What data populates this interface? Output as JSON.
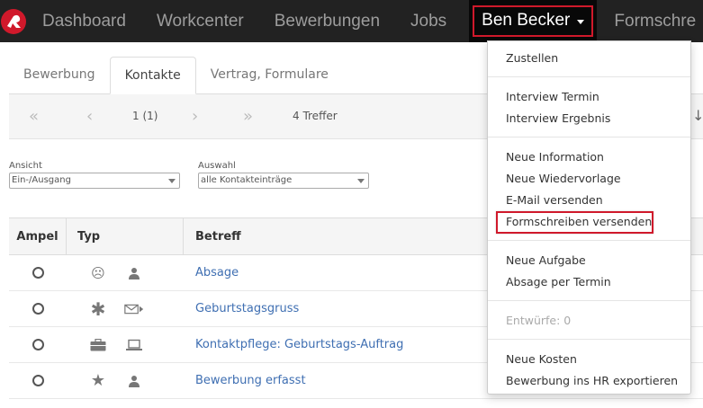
{
  "navbar": {
    "items": [
      "Dashboard",
      "Workcenter",
      "Bewerbungen",
      "Jobs"
    ],
    "user": "Ben Becker",
    "cut_item": "Formschre"
  },
  "tabs": [
    "Bewerbung",
    "Kontakte",
    "Vertrag, Formulare"
  ],
  "pager": {
    "page": "1 (1)",
    "count": "4 Treffer"
  },
  "filters": {
    "ansicht": {
      "label": "Ansicht",
      "value": "Ein-/Ausgang"
    },
    "auswahl": {
      "label": "Auswahl",
      "value": "alle Kontakteinträge"
    }
  },
  "table": {
    "headers": [
      "Ampel",
      "Typ",
      "Betreff"
    ],
    "rows": [
      {
        "betreff": "Absage",
        "icons": [
          "frown-icon",
          "person-icon"
        ]
      },
      {
        "betreff": "Geburtstagsgruss",
        "icons": [
          "asterisk-icon",
          "mail-send-icon"
        ]
      },
      {
        "betreff": "Kontaktpflege: Geburtstags-Auftrag",
        "icons": [
          "briefcase-icon",
          "laptop-icon"
        ]
      },
      {
        "betreff": "Bewerbung erfasst",
        "icons": [
          "star-icon",
          "person-icon"
        ]
      }
    ]
  },
  "dropdown": {
    "items": [
      "Zustellen",
      "Interview Termin",
      "Interview Ergebnis",
      "Neue Information",
      "Neue Wiedervorlage",
      "E-Mail versenden",
      "Formschreiben versenden",
      "Neue Aufgabe",
      "Absage per Termin",
      "Entwürfe: 0",
      "Neue Kosten",
      "Bewerbung ins HR exportieren"
    ]
  },
  "colors": {
    "navbar_bg": "#222222",
    "highlight": "#d0192b",
    "link": "#3f6fb2"
  }
}
